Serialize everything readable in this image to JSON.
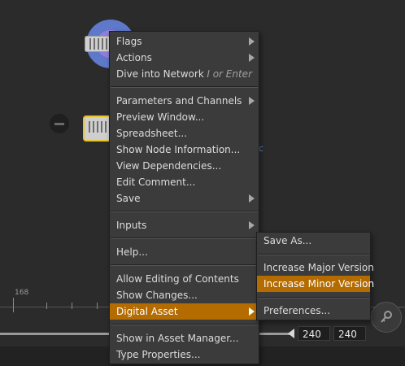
{
  "network": {
    "node_suffix": "c"
  },
  "context_menu": {
    "items": [
      {
        "label": "Flags"
      },
      {
        "label": "Actions"
      },
      {
        "label": "Dive into Network",
        "shortcut": "I or Enter"
      },
      {
        "label": "Parameters and Channels"
      },
      {
        "label": "Preview Window..."
      },
      {
        "label": "Spreadsheet..."
      },
      {
        "label": "Show Node Information..."
      },
      {
        "label": "View Dependencies..."
      },
      {
        "label": "Edit Comment..."
      },
      {
        "label": "Save"
      },
      {
        "label": "Inputs"
      },
      {
        "label": "Help..."
      },
      {
        "label": "Allow Editing of Contents"
      },
      {
        "label": "Show Changes..."
      },
      {
        "label": "Digital Asset"
      },
      {
        "label": "Show in Asset Manager..."
      },
      {
        "label": "Type Properties..."
      }
    ]
  },
  "submenu": {
    "items": [
      {
        "label": "Save As..."
      },
      {
        "label": "Increase Major Version"
      },
      {
        "label": "Increase Minor Version"
      },
      {
        "label": "Preferences..."
      }
    ]
  },
  "timeline": {
    "frame_label": "168",
    "start_frame": "240",
    "end_frame": "240"
  },
  "colors": {
    "highlight": "#b46b00",
    "selected_node_border": "#e7c22a",
    "menu_bg": "#3b3b3b"
  }
}
